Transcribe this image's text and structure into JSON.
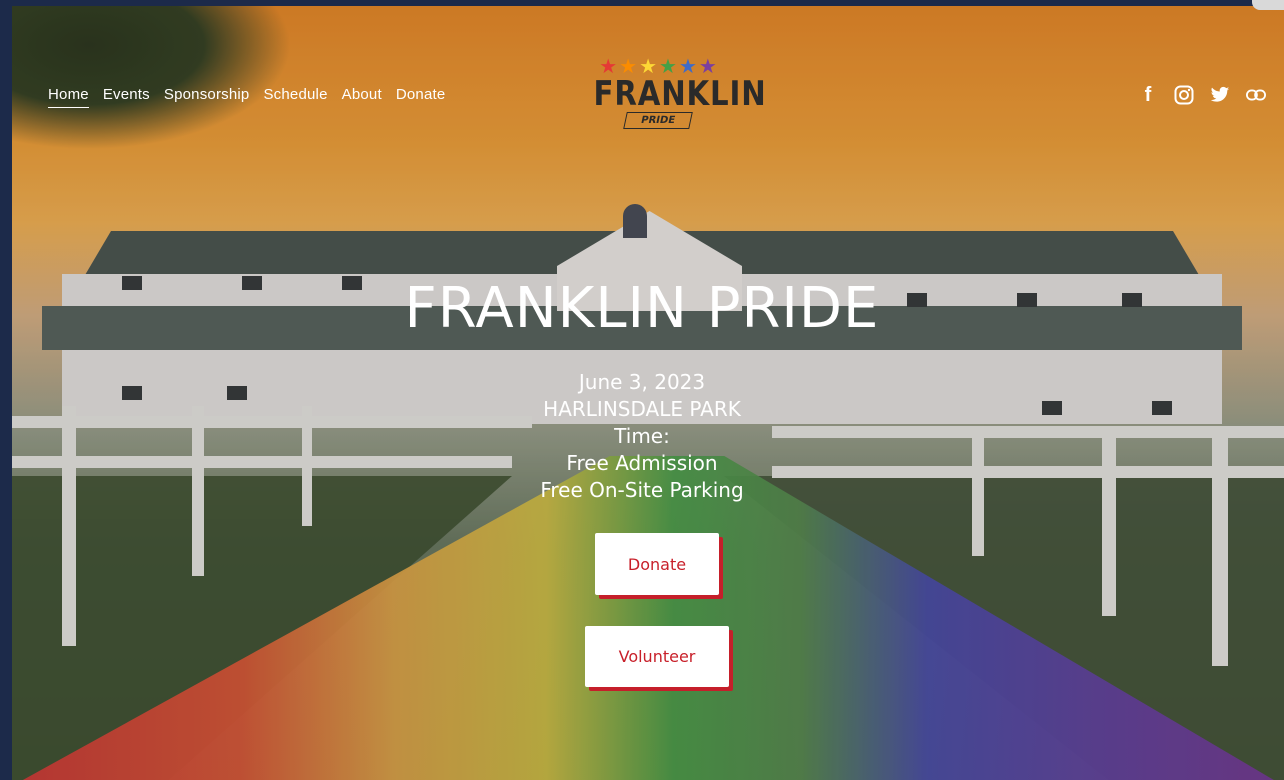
{
  "nav": {
    "items": [
      {
        "label": "Home",
        "active": true
      },
      {
        "label": "Events"
      },
      {
        "label": "Sponsorship"
      },
      {
        "label": "Schedule"
      },
      {
        "label": "About"
      },
      {
        "label": "Donate"
      }
    ]
  },
  "logo": {
    "word": "FRANKLIN",
    "sub": "PRIDE",
    "stars": [
      "#e53935",
      "#fb8c00",
      "#fdd835",
      "#43a047",
      "#3f6bc8",
      "#7b3fa0"
    ]
  },
  "social": [
    {
      "icon": "facebook-icon",
      "glyph": "f"
    },
    {
      "icon": "instagram-icon",
      "glyph": "◎"
    },
    {
      "icon": "twitter-icon",
      "glyph": "🐦"
    },
    {
      "icon": "link-icon",
      "glyph": "⊂⊃"
    }
  ],
  "hero": {
    "title": "FRANKLIN PRIDE",
    "date": "June 3, 2023",
    "venue": "HARLINSDALE PARK",
    "time": "Time:",
    "admission": "Free Admission",
    "parking": "Free On-Site Parking"
  },
  "buttons": {
    "donate": "Donate",
    "volunteer": "Volunteer",
    "accent_color": "#c8202a"
  }
}
